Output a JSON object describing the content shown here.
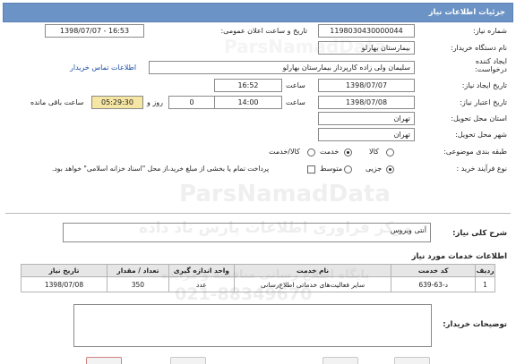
{
  "title_bar": {
    "text": "جزئیات اطلاعات نیاز"
  },
  "fields": {
    "need_number": {
      "label": "شماره نیاز:",
      "value": "1198030430000044"
    },
    "announce_datetime": {
      "label": "تاریخ و ساعت اعلان عمومی:",
      "value": "1398/07/07 - 16:53"
    },
    "buyer_org": {
      "label": "نام دستگاه خریدار:",
      "value": "بیمارستان بهارلو"
    },
    "request_creator": {
      "label": "ایجاد کننده درخواست:",
      "value": "سلیمان  ولی زاده  کارپرداز بیمارستان بهارلو"
    },
    "buyer_contact_link": "اطلاعات تماس خریدار",
    "need_date": {
      "label": "تاریخ ایجاد نیاز:",
      "date": "1398/07/07",
      "time_label": "ساعت",
      "time": "16:52"
    },
    "validity": {
      "label": "تاریخ اعتبار نیاز:",
      "date": "1398/07/08",
      "time_label": "ساعت",
      "time": "14:00",
      "days": "0",
      "days_label": "روز و",
      "remaining": "05:29:30",
      "remaining_label": "ساعت باقی مانده"
    },
    "delivery_province": {
      "label": "استان محل تحویل:",
      "value": "تهران"
    },
    "delivery_city": {
      "label": "شهر محل تحویل:",
      "value": "تهران"
    },
    "category": {
      "label": "طبقه بندی موضوعی:",
      "options": [
        "کالا",
        "خدمت",
        "کالا/خدمت"
      ],
      "selected": "خدمت"
    },
    "purchase_type": {
      "label": "نوع فرآیند خرید :",
      "options": [
        "جزیی",
        "متوسط"
      ],
      "selected": "جزیی",
      "note": "پرداخت تمام یا بخشی از مبلغ خرید،از محل \"اسناد خزانه اسلامی\" خواهد بود."
    }
  },
  "summary": {
    "label": "شرح کلی نیاز:",
    "value": "آنتی ویروس"
  },
  "services_section": {
    "title": "اطلاعات خدمات مورد نیاز"
  },
  "table": {
    "headers": [
      "ردیف",
      "کد خدمت",
      "نام خدمت",
      "واحد اندازه گیری",
      "تعداد / مقدار",
      "تاریخ نیاز"
    ],
    "rows": [
      [
        "1",
        "د-63-639",
        "سایر فعالیت‌های خدماتی اطلاع‌رسانی",
        "عدد",
        "350",
        "1398/07/08"
      ]
    ]
  },
  "buyer_notes": {
    "label": "توضیحات خریدار:"
  },
  "watermarks": [
    "مرکز فراوری اطلاعات پارس ناد داده",
    "ParsNamadData",
    "پایگاه اطلاع رسانی مناقصه و مزایده",
    "021-88349670",
    "ParsNamadData"
  ]
}
